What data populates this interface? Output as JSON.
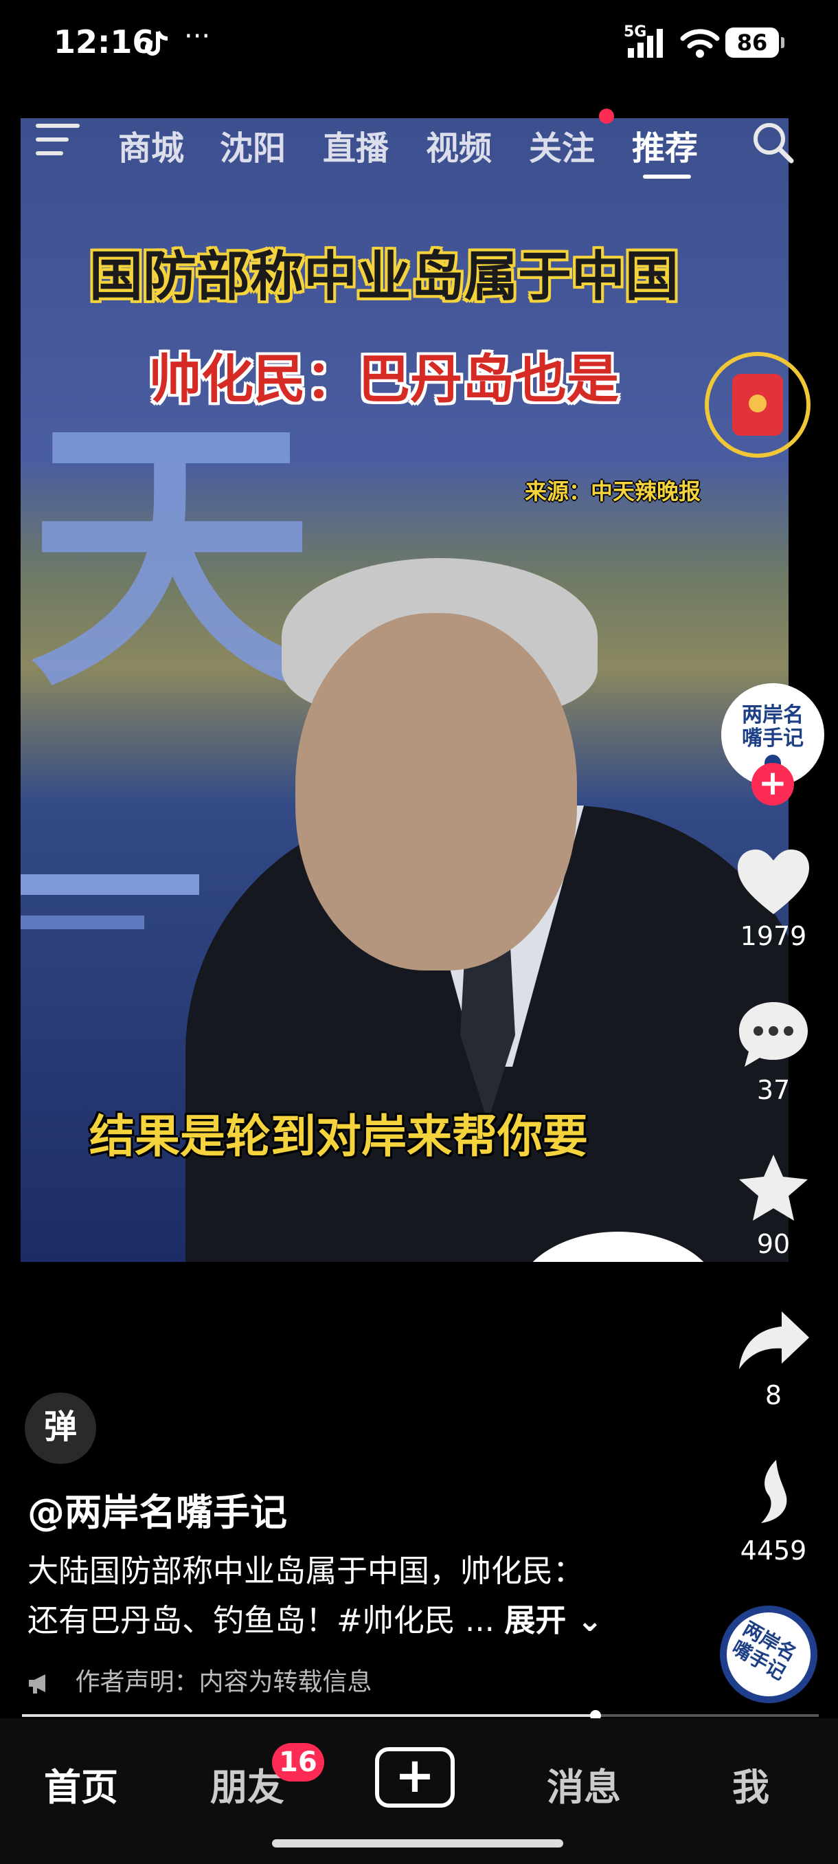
{
  "status_bar": {
    "time": "12:16",
    "dots": "···",
    "network": "5G",
    "battery": "86"
  },
  "top_nav": {
    "tabs": [
      "商城",
      "沈阳",
      "直播",
      "视频",
      "关注",
      "推荐"
    ],
    "active_tab": "推荐",
    "icons": [
      "menu-icon",
      "search-icon"
    ],
    "accent_color": "#fe2c55"
  },
  "video": {
    "title_line1": "国防部称中业岛属于中国",
    "title_line2": "帅化民：巴丹岛也是",
    "source_tag": "来源：中天辣晚报",
    "subtitle": "结果是轮到对岸来帮你要",
    "studio_backdrop_text": "天"
  },
  "right_rail": {
    "avatar_text": "两岸名嘴手记",
    "likes": "1979",
    "comments": "37",
    "favorites": "90",
    "shares": "8",
    "recommend": "4459",
    "music_disc_text": "两岸名嘴手记"
  },
  "caption": {
    "danmu_label": "弹",
    "author": "@两岸名嘴手记",
    "desc_line1": "大陆国防部称中业岛属于中国，帅化民：",
    "desc_line2": "还有巴丹岛、钓鱼岛！#帅化民 ...",
    "expand": "展开",
    "notice": "作者声明：内容为转载信息"
  },
  "progress": {
    "fraction": 0.72
  },
  "bottom_nav": {
    "home": "首页",
    "friends": "朋友",
    "friends_badge": "16",
    "create": "+",
    "messages": "消息",
    "me": "我"
  }
}
